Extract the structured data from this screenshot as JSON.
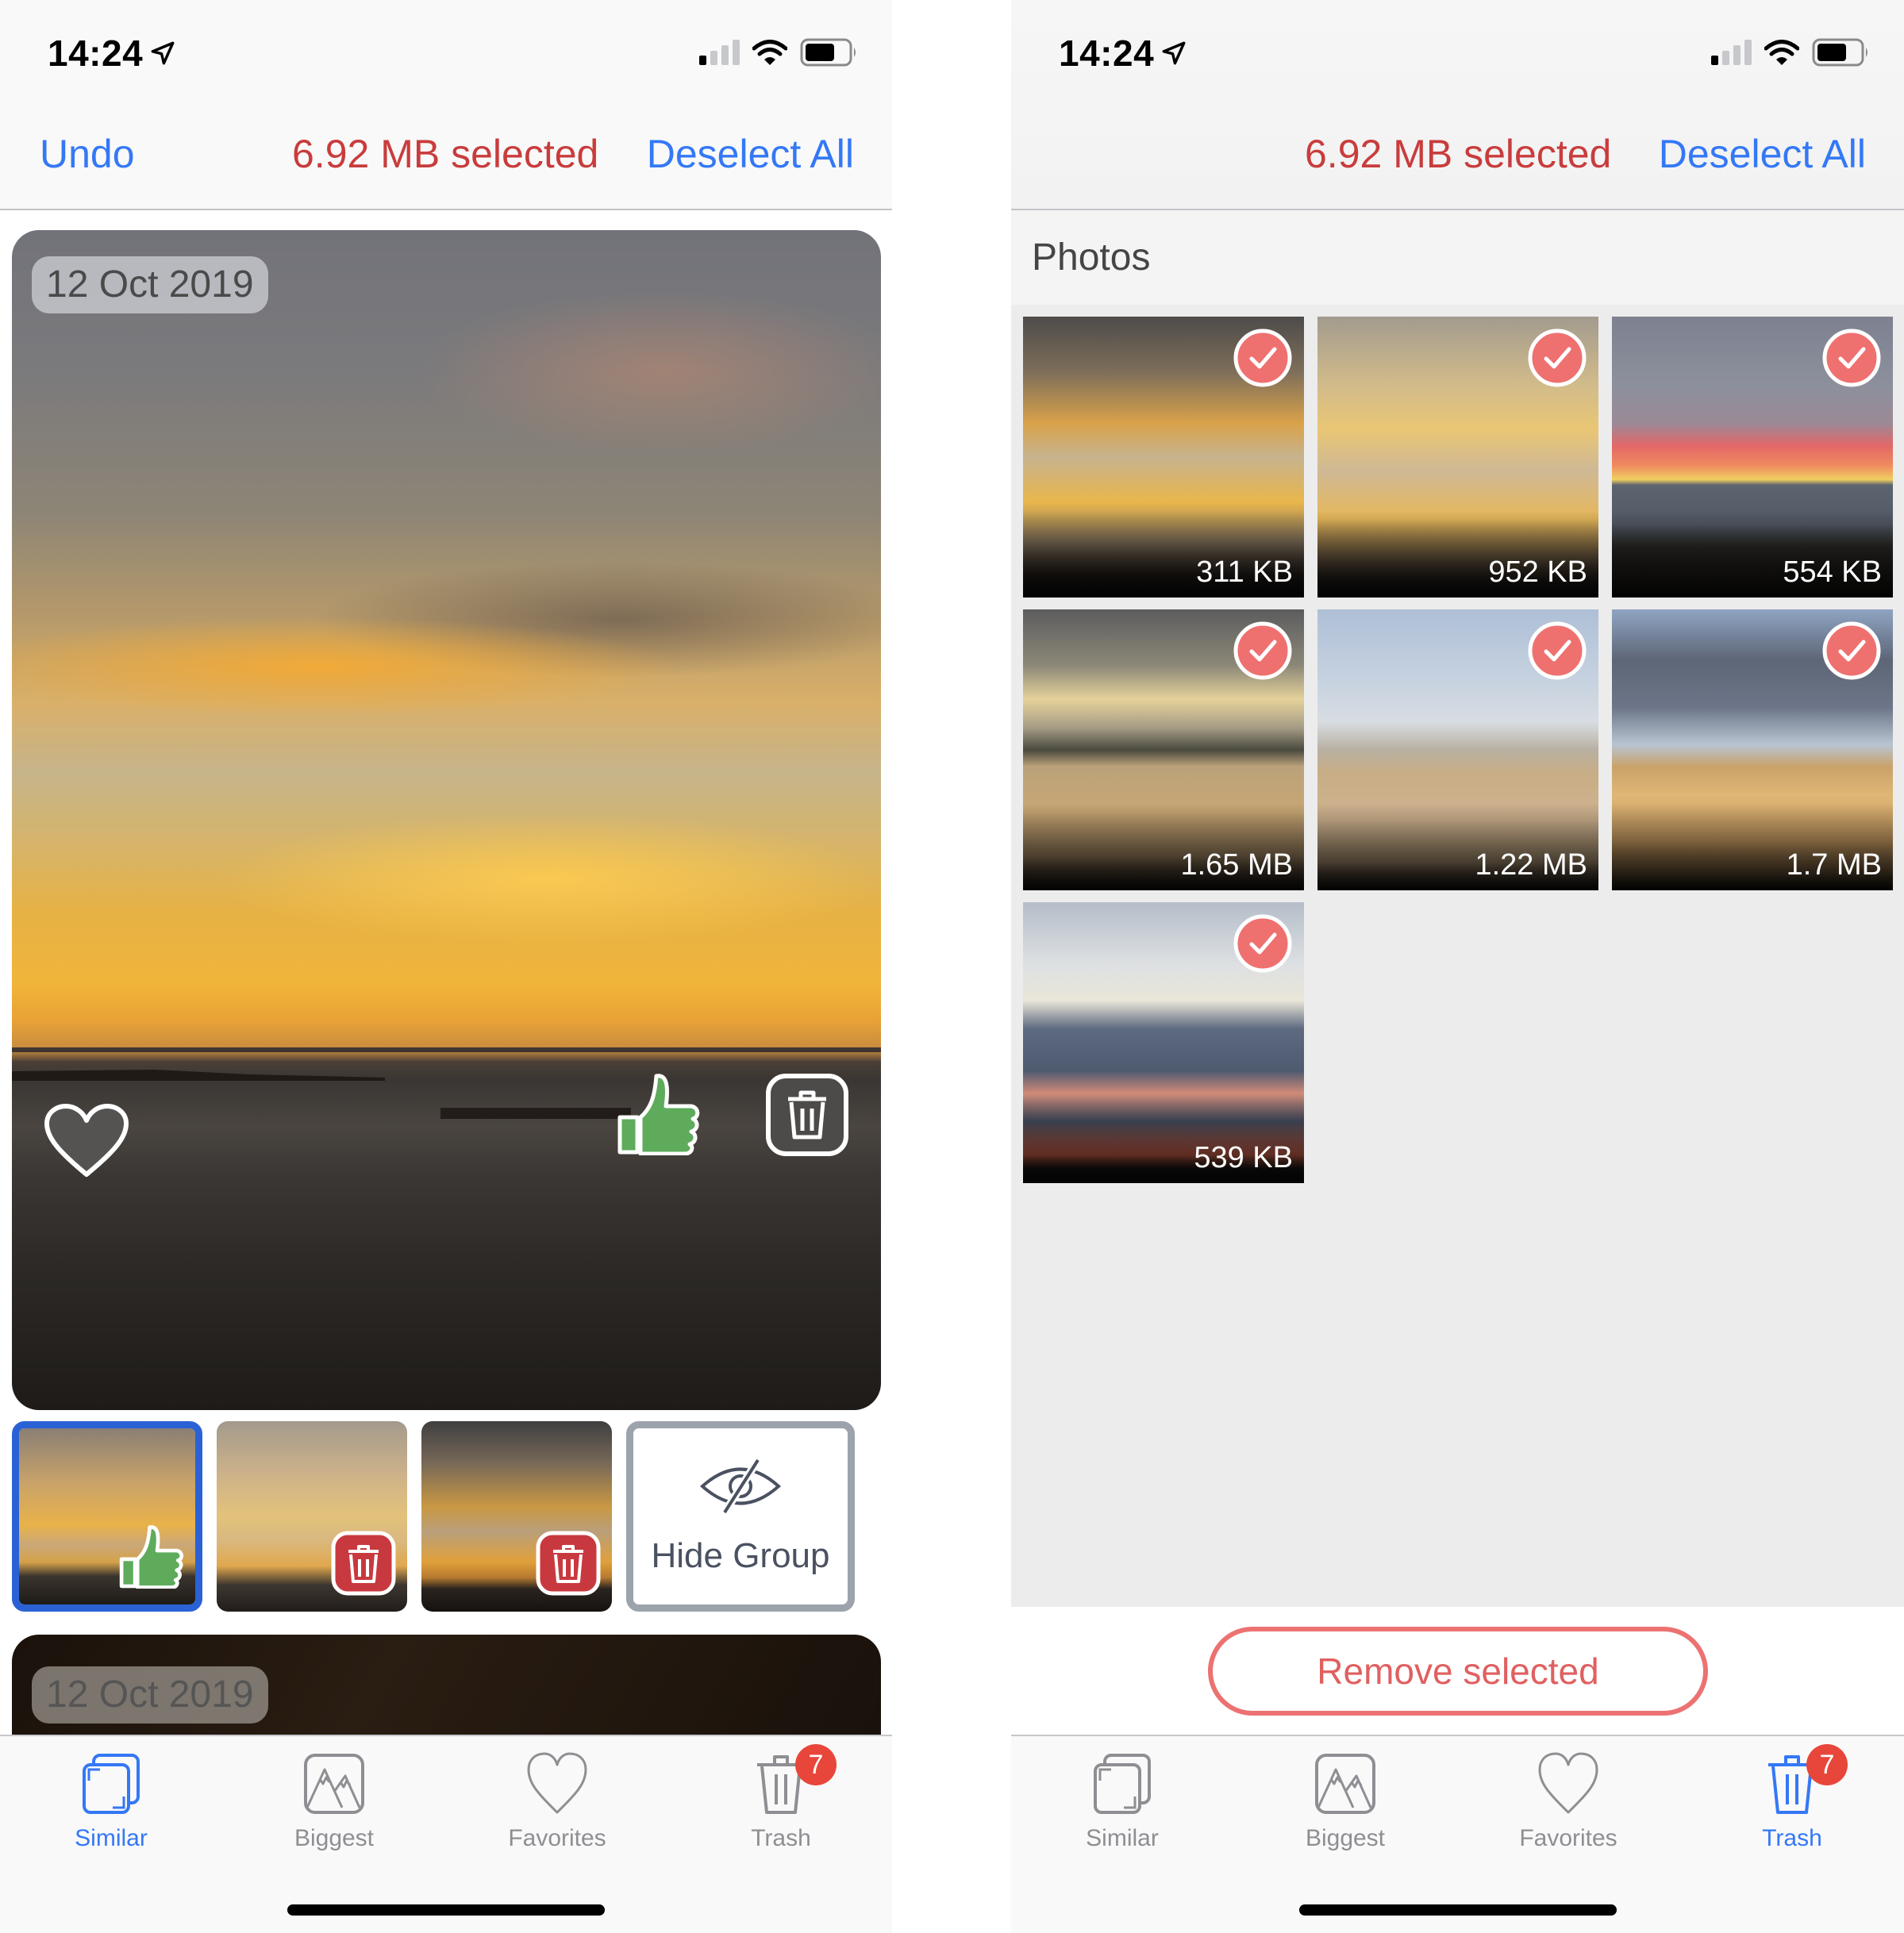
{
  "status_bar": {
    "time": "14:24",
    "location_icon": "location-arrow-icon",
    "signal_bars_on": 1,
    "signal_bars_total": 4,
    "battery_level": 0.7
  },
  "left_screen": {
    "nav": {
      "undo_label": "Undo",
      "selected_label": "6.92 MB selected",
      "deselect_label": "Deselect All"
    },
    "main_card": {
      "date": "12 Oct 2019",
      "actions": [
        "heart-icon",
        "thumbs-up-icon",
        "trash-icon"
      ]
    },
    "thumbnails": [
      {
        "state": "keep",
        "selected": true,
        "badge": "thumbs-up-icon"
      },
      {
        "state": "delete",
        "selected": false,
        "badge": "trash-icon"
      },
      {
        "state": "delete",
        "selected": false,
        "badge": "trash-icon"
      }
    ],
    "hide_group_label": "Hide Group",
    "next_card": {
      "date": "12 Oct 2019"
    },
    "active_tab": "Similar"
  },
  "right_screen": {
    "nav": {
      "selected_label": "6.92 MB selected",
      "deselect_label": "Deselect All"
    },
    "section_title": "Photos",
    "photos": [
      {
        "size": "311 KB",
        "selected": true
      },
      {
        "size": "952 KB",
        "selected": true
      },
      {
        "size": "554 KB",
        "selected": true
      },
      {
        "size": "1.65 MB",
        "selected": true
      },
      {
        "size": "1.22 MB",
        "selected": true
      },
      {
        "size": "1.7 MB",
        "selected": true
      },
      {
        "size": "539 KB",
        "selected": true
      }
    ],
    "remove_button_label": "Remove selected",
    "active_tab": "Trash"
  },
  "tabs": [
    {
      "label": "Similar",
      "icon": "similar-icon"
    },
    {
      "label": "Biggest",
      "icon": "mountains-icon"
    },
    {
      "label": "Favorites",
      "icon": "heart-icon"
    },
    {
      "label": "Trash",
      "icon": "trash-icon",
      "badge": "7"
    }
  ],
  "colors": {
    "accent_blue": "#3478f6",
    "selected_red": "#c93c3c",
    "check_red": "#ee7170",
    "keep_green": "#5eab5c",
    "delete_red": "#c8393f",
    "badge_red": "#e8463b",
    "inactive_gray": "#8e8e93"
  }
}
